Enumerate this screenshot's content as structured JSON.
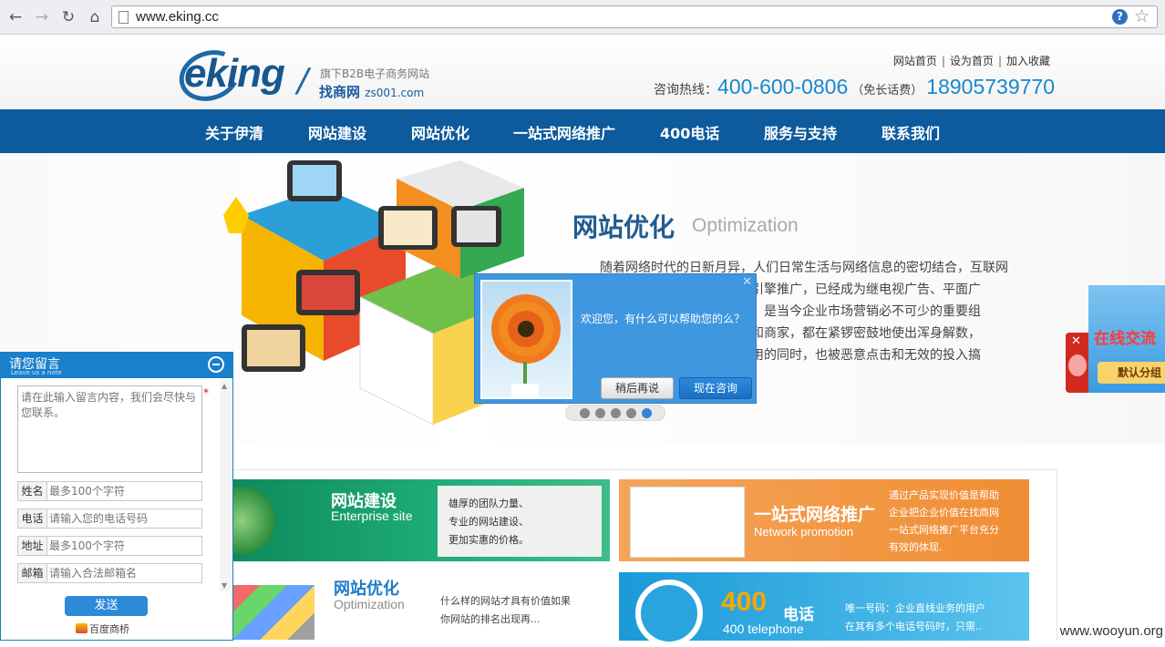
{
  "browser": {
    "url": "www.eking.cc"
  },
  "header": {
    "brand": "eking",
    "slogan_line1": "旗下B2B电子商务网站",
    "slogan_line2": "找商网",
    "slogan_domain": "zs001.com",
    "top_links": [
      "网站首页",
      "设为首页",
      "加入收藏"
    ],
    "hotline_label": "咨询热线：",
    "hotline_number": "400-600-0806",
    "hotline_free": "（免长话费）",
    "mobile_number": "18905739770"
  },
  "nav": {
    "items": [
      "关于伊清",
      "网站建设",
      "网站优化",
      "一站式网络推广",
      "400电话",
      "服务与支持",
      "联系我们"
    ]
  },
  "banner": {
    "title": "网站优化",
    "title_en": "Optimization",
    "text_lines": [
      "随着网络时代的日新月异，人们日常生活与网络信息的密切结合，互联网",
      "搜索引擎推广，已经成为继电视广告、平面广",
      "平台，是当今企业市场营销必不可少的重要组",
      "单位和商家，都在紧锣密鼓地使出浑身解数，",
      "额费用的同时，也被恶意点击和无效的投入搞"
    ],
    "slide_count": 5,
    "active_slide": 5
  },
  "chat_popup": {
    "message": "欢迎您，有什么可以帮助您的么？",
    "later_label": "稍后再说",
    "now_label": "现在咨询"
  },
  "right_float": {
    "title": "在线交流",
    "subtitle": "默认分组"
  },
  "services": {
    "site_building": {
      "title": "网站建设",
      "title_en": "Enterprise site",
      "desc": [
        "雄厚的团队力量、",
        "专业的网站建设、",
        "更加实惠的价格。"
      ]
    },
    "promotion": {
      "title": "一站式网络推广",
      "title_en": "Network promotion",
      "desc": [
        "通过产品实现价值是帮助",
        "企业把企业价值在找商网",
        "一站式网络推广平台充分",
        "有效的体现."
      ]
    },
    "optimization": {
      "title": "网站优化",
      "title_en": "Optimization",
      "desc": [
        "什么样的网站才具有价值如果",
        "你网站的排名出现再..."
      ]
    },
    "telephone": {
      "title_num": "400",
      "title": "电话",
      "title_en": "400 telephone",
      "desc": [
        "唯一号码：企业直线业务的用户",
        "在其有多个电话号码时，只需.."
      ]
    }
  },
  "note_panel": {
    "title": "请您留言",
    "subtitle": "Leave us a note",
    "message_placeholder": "请在此输入留言内容，我们会尽快与您联系。",
    "fields": [
      {
        "label": "姓名",
        "placeholder": "最多100个字符"
      },
      {
        "label": "电话",
        "placeholder": "请输入您的电话号码"
      },
      {
        "label": "地址",
        "placeholder": "最多100个字符"
      },
      {
        "label": "邮箱",
        "placeholder": "请输入合法邮箱名"
      }
    ],
    "send_label": "发送",
    "footer": "百度商桥"
  },
  "watermark": "www.wooyun.org"
}
